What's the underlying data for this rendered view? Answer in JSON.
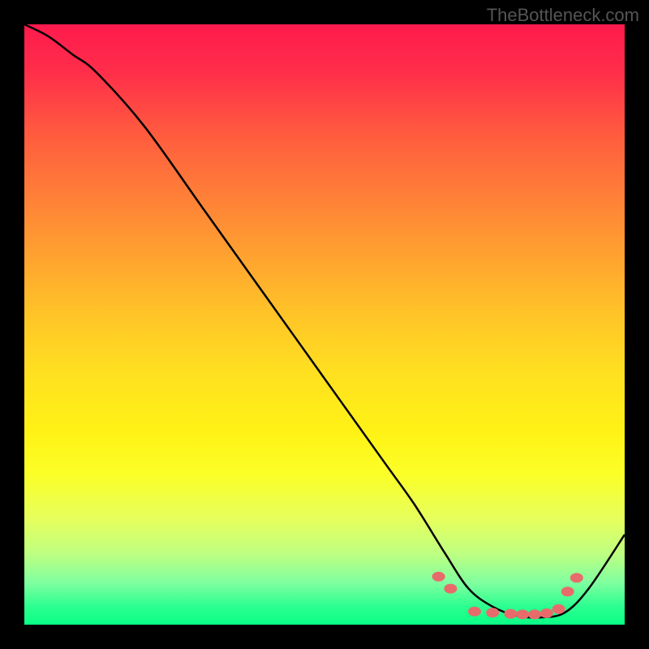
{
  "watermark": "TheBottleneck.com",
  "chart_data": {
    "type": "line",
    "title": "",
    "xlabel": "",
    "ylabel": "",
    "xlim": [
      0,
      100
    ],
    "ylim": [
      0,
      100
    ],
    "series": [
      {
        "name": "curve",
        "x": [
          0,
          4,
          8,
          12,
          20,
          30,
          40,
          50,
          60,
          65,
          70,
          74,
          78,
          82,
          86,
          90,
          94,
          100
        ],
        "y": [
          100,
          98,
          95,
          92,
          83,
          69,
          55,
          41,
          27,
          20,
          12,
          6,
          3,
          1.5,
          1.2,
          2,
          6,
          15
        ]
      }
    ],
    "markers": {
      "name": "dots",
      "x": [
        69,
        71,
        75,
        78,
        81,
        83,
        85,
        87,
        89,
        90.5,
        92
      ],
      "y": [
        8,
        6,
        2.2,
        2,
        1.8,
        1.7,
        1.7,
        1.9,
        2.6,
        5.5,
        7.8
      ]
    }
  }
}
